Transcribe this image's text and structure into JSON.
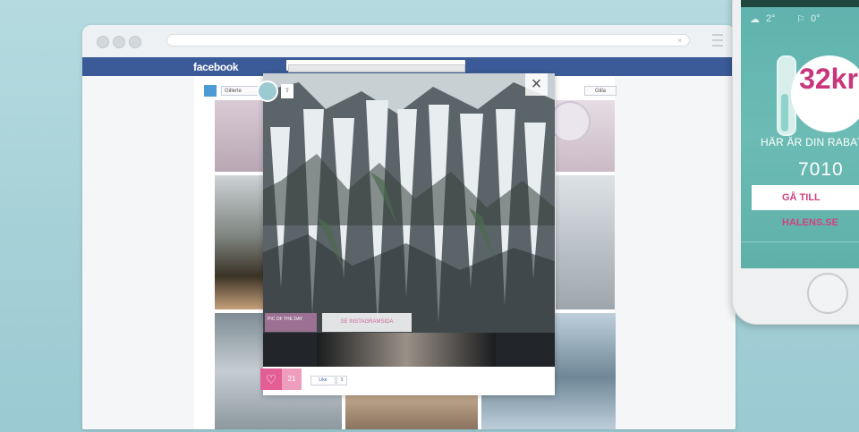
{
  "browser": {
    "url_text": "",
    "close_glyph": "×"
  },
  "facebook": {
    "logo": "facebook",
    "search_text": "",
    "right_text": ""
  },
  "app_bar": {
    "logo_text": "",
    "tab_label": "Gillerte",
    "like_label": "Gilla"
  },
  "modal": {
    "close_glyph": "×",
    "topbar_text": "",
    "badge_text": "PIC OF THE DAY",
    "link_text": "SE INSTAGRAMSIDA",
    "heart_glyph": "♡",
    "heart_count": "21",
    "fb_like": "Like",
    "fb_like_count": "3",
    "pin_glyph": "⇪"
  },
  "phone": {
    "status_text": "",
    "weather": [
      {
        "icon": "cloud-icon",
        "text": "2°"
      },
      {
        "icon": "wind-icon",
        "text": "0°"
      }
    ],
    "discount_value": "32kr",
    "discount_subtext": "",
    "heading": "HÄR ÄR DIN RABATT",
    "heading_sub": "",
    "code": "7010",
    "cta_label": "GÅ TILL HALENS.SE",
    "cta_fine": "",
    "share_text": ""
  },
  "colors": {
    "background": "#a9d3d9",
    "facebook_blue": "#3b5b98",
    "accent_pink": "#e35e94",
    "phone_teal": "#5fb2ad"
  }
}
